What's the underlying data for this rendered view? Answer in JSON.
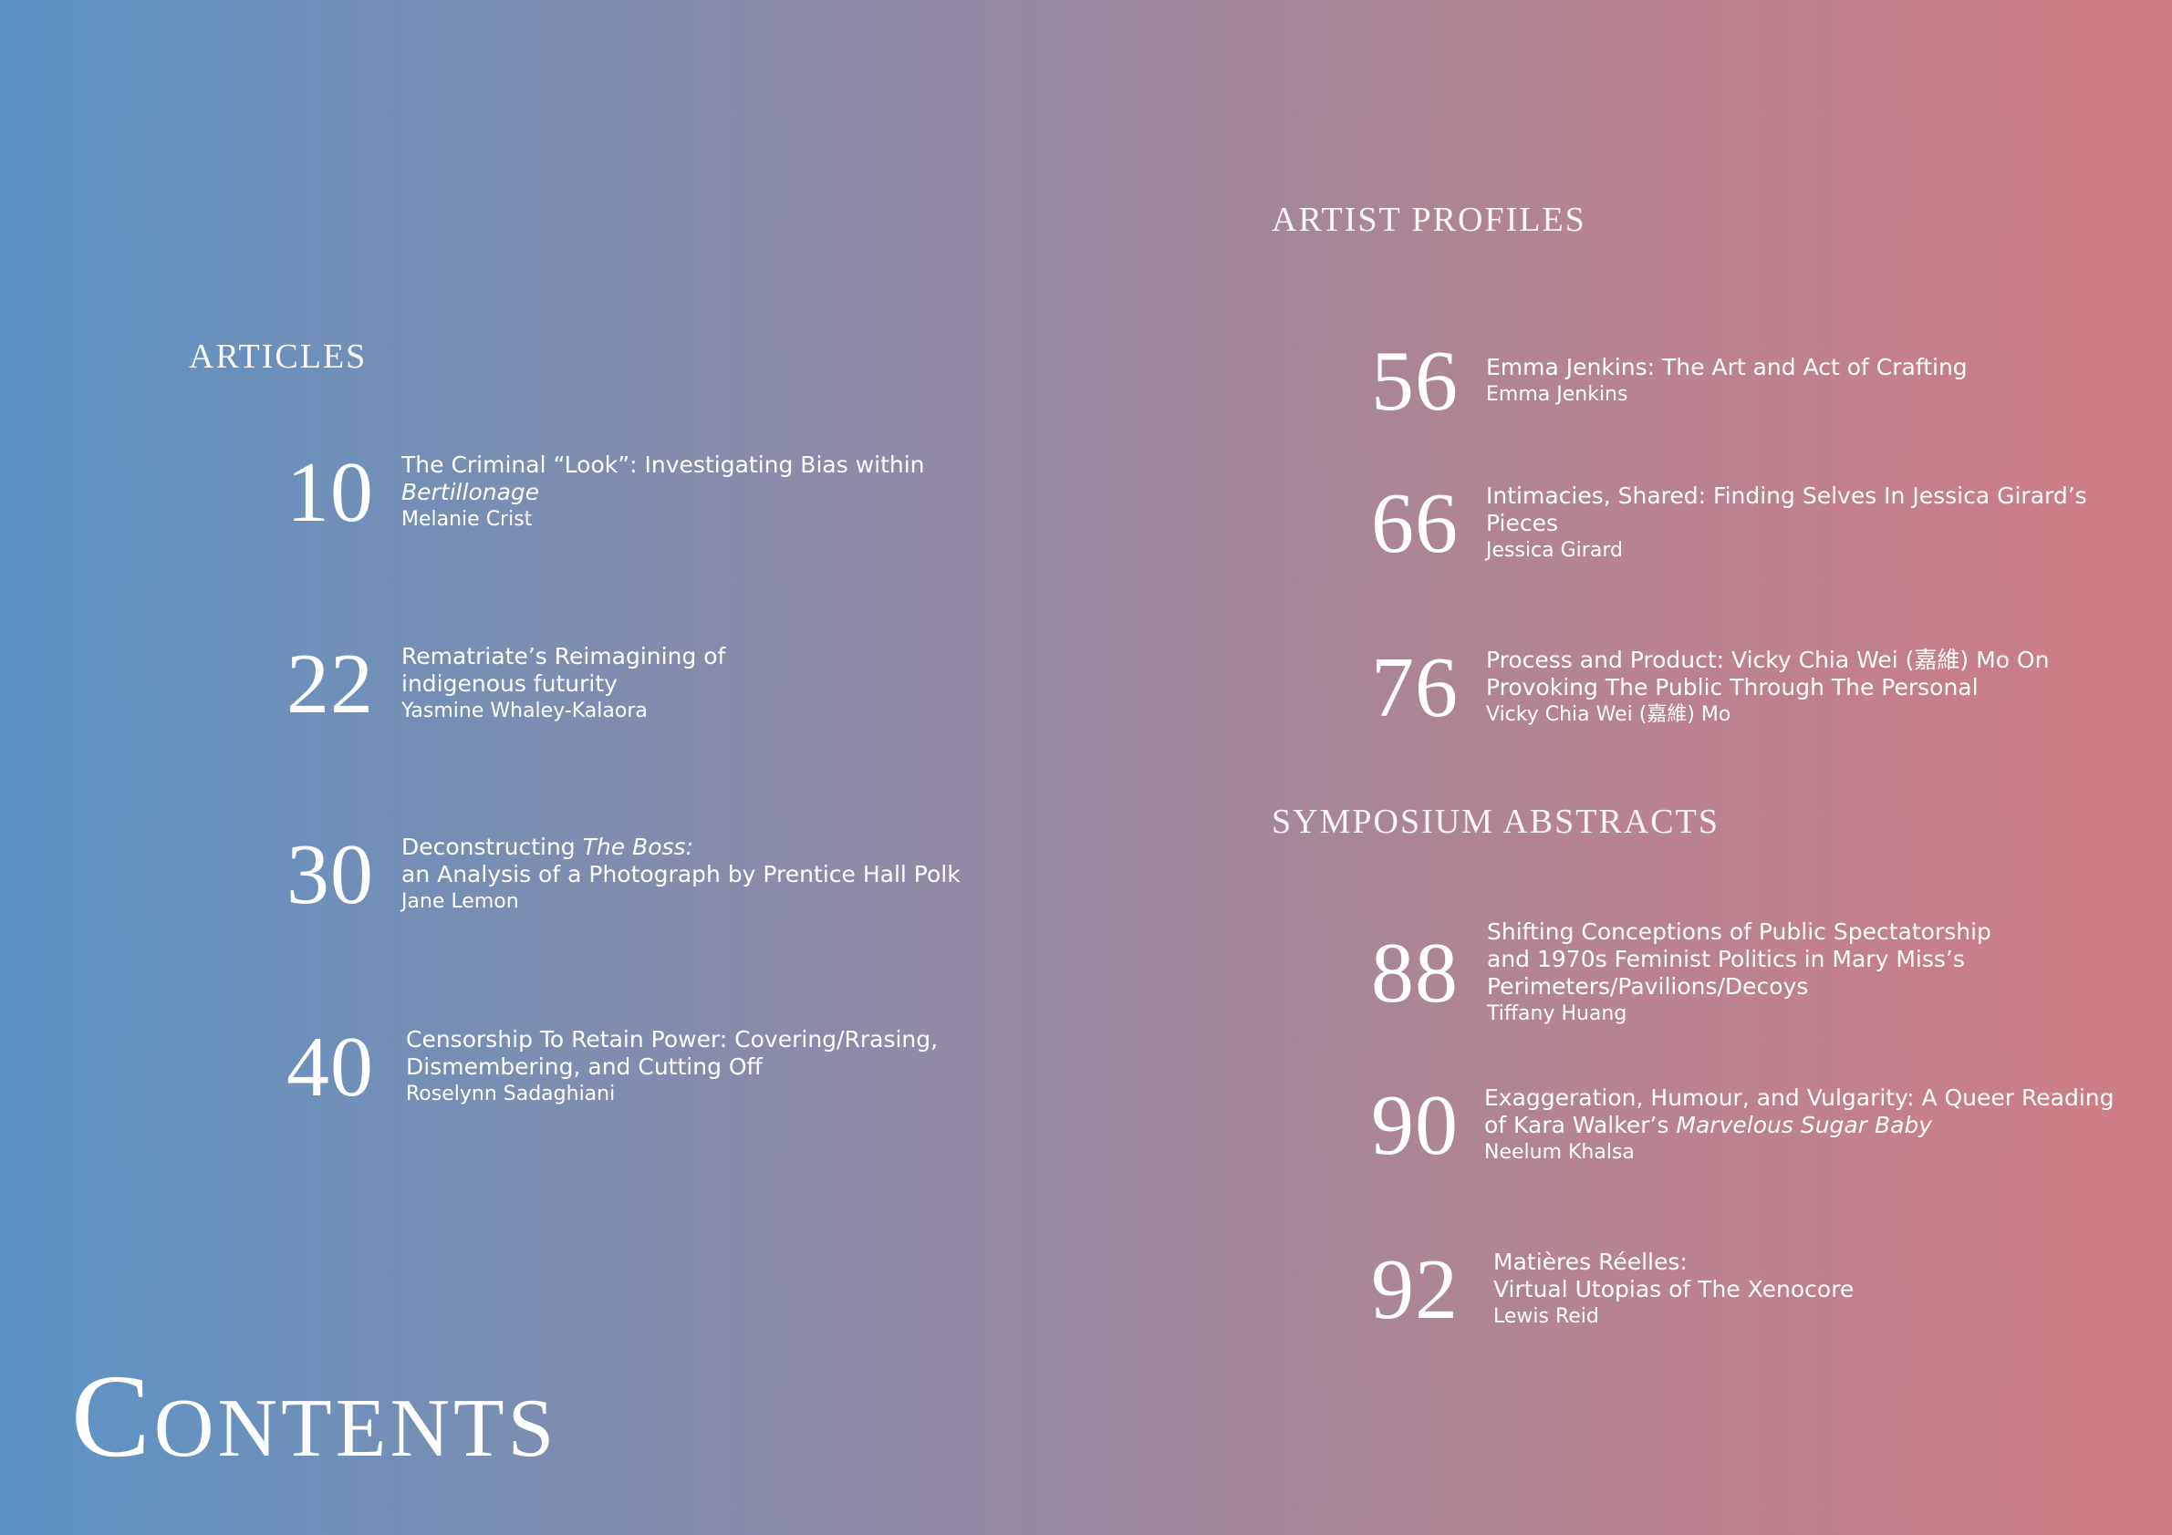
{
  "contents_title": "Contents",
  "articles": {
    "heading": "Articles",
    "entries": [
      {
        "page": "10",
        "title_lines": [
          "The Criminal “Look”: Investigating Bias within"
        ],
        "title_italic": "Bertillonage",
        "author": "Melanie Crist"
      },
      {
        "page": "22",
        "title_lines": [
          "Rematriate’s Reimagining of",
          "indigenous futurity"
        ],
        "author": "Yasmine Whaley-Kalaora"
      },
      {
        "page": "30",
        "title_prefix": "Deconstructing ",
        "title_italic": "The Boss:",
        "title_lines": [
          "an Analysis of a Photograph by Prentice Hall Polk"
        ],
        "author": "Jane Lemon"
      },
      {
        "page": "40",
        "title_lines": [
          "Censorship To Retain Power: Covering/Rrasing,",
          "Dismembering, and Cutting Off"
        ],
        "author": "Roselynn Sadaghiani"
      }
    ]
  },
  "artist_profiles": {
    "heading": "Artist Profiles",
    "entries": [
      {
        "page": "56",
        "title_lines": [
          "Emma Jenkins: The Art and Act of Crafting"
        ],
        "author": "Emma Jenkins"
      },
      {
        "page": "66",
        "title_lines": [
          "Intimacies, Shared: Finding Selves In Jessica Girard’s",
          "Pieces"
        ],
        "author": "Jessica Girard"
      },
      {
        "page": "76",
        "title_lines": [
          "Process and Product: Vicky Chia Wei (嘉維) Mo On",
          "Provoking The Public  Through The Personal"
        ],
        "author": "Vicky Chia Wei (嘉維) Mo"
      }
    ]
  },
  "symposium_abstracts": {
    "heading": "Symposium Abstracts",
    "entries": [
      {
        "page": "88",
        "title_lines": [
          "Shifting Conceptions of Public Spectatorship",
          "and 1970s Feminist Politics in Mary Miss’s",
          "Perimeters/Pavilions/Decoys"
        ],
        "author": "Tiffany Huang"
      },
      {
        "page": "90",
        "title_lines": [
          "Exaggeration, Humour, and Vulgarity: A Queer Reading"
        ],
        "title_suffix_prefix": "of Kara Walker’s  ",
        "title_italic": "Marvelous Sugar Baby",
        "author": "Neelum Khalsa"
      },
      {
        "page": "92",
        "title_lines": [
          "Matières Réelles:",
          "Virtual Utopias of The Xenocore"
        ],
        "author": "Lewis Reid"
      }
    ]
  }
}
